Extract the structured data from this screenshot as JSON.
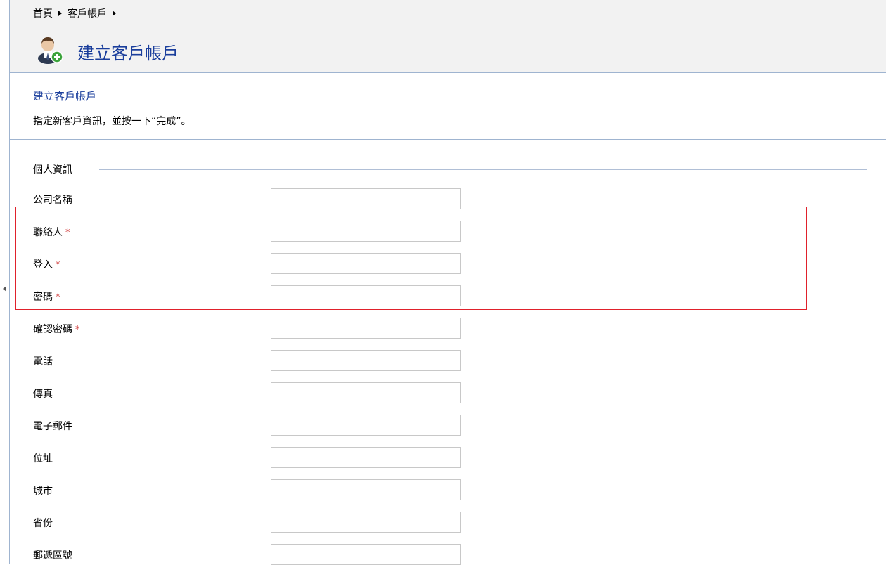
{
  "breadcrumb": {
    "items": [
      "首頁",
      "客戶帳戶"
    ]
  },
  "header": {
    "title": "建立客戶帳戶",
    "icon": "add-user-icon"
  },
  "description": {
    "title": "建立客戶帳戶",
    "text": "指定新客戶資訊，並按一下“完成”。"
  },
  "section": {
    "title": "個人資訊"
  },
  "form": {
    "fields": [
      {
        "label": "公司名稱",
        "required": false,
        "value": ""
      },
      {
        "label": "聯絡人",
        "required": true,
        "value": ""
      },
      {
        "label": "登入",
        "required": true,
        "value": ""
      },
      {
        "label": "密碼",
        "required": true,
        "value": ""
      },
      {
        "label": "確認密碼",
        "required": true,
        "value": ""
      },
      {
        "label": "電話",
        "required": false,
        "value": ""
      },
      {
        "label": "傳真",
        "required": false,
        "value": ""
      },
      {
        "label": "電子郵件",
        "required": false,
        "value": ""
      },
      {
        "label": "位址",
        "required": false,
        "value": ""
      },
      {
        "label": "城市",
        "required": false,
        "value": ""
      },
      {
        "label": "省份",
        "required": false,
        "value": ""
      },
      {
        "label": "郵遞區號",
        "required": false,
        "value": ""
      }
    ],
    "required_marker": "*"
  },
  "colors": {
    "accent": "#1a3e9c",
    "required": "#d04040",
    "highlight": "#e0212b"
  }
}
